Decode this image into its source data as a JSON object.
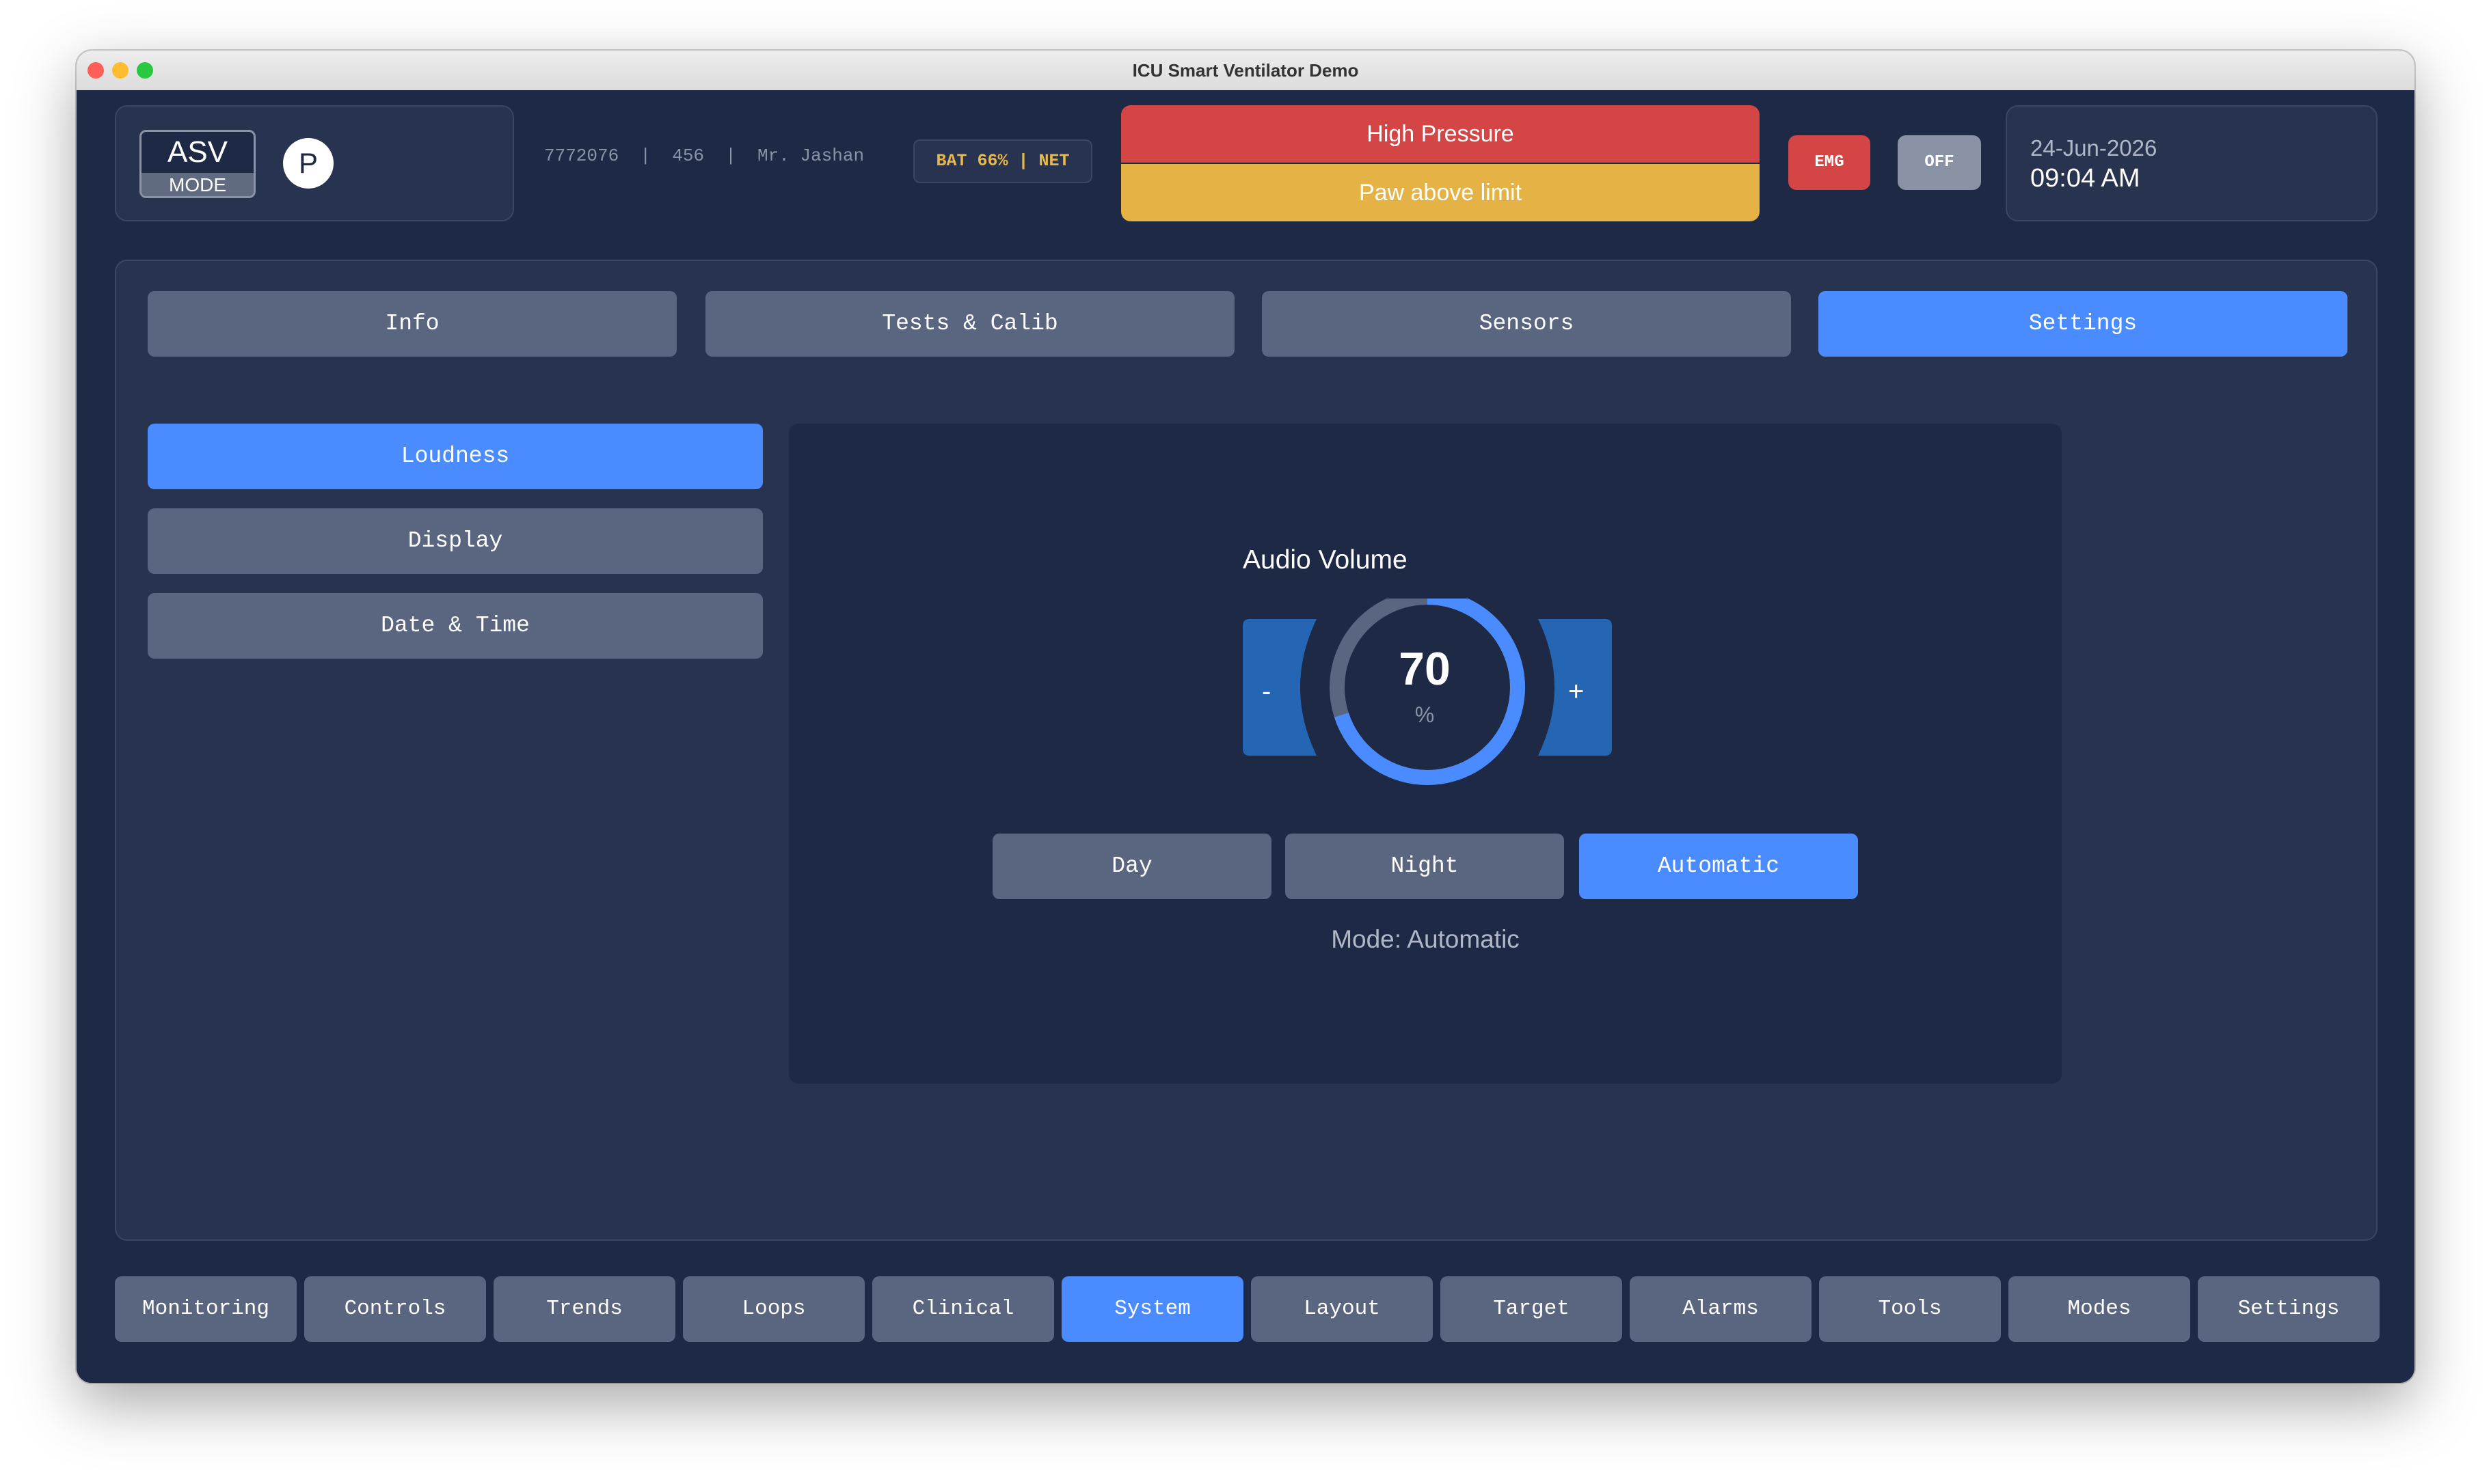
{
  "window": {
    "title": "ICU Smart Ventilator Demo"
  },
  "header": {
    "mode": {
      "name": "ASV",
      "label": "MODE",
      "badge": "P"
    },
    "patient_info": "7772076  |  456  |  Mr. Jashan",
    "status": "BAT 66% | NET",
    "alarms": {
      "primary": "High Pressure",
      "secondary": "Paw above limit"
    },
    "emg_label": "EMG",
    "off_label": "OFF",
    "date": "24-Jun-2026",
    "time": "09:04 AM"
  },
  "top_tabs": [
    {
      "label": "Info",
      "active": false
    },
    {
      "label": "Tests & Calib",
      "active": false
    },
    {
      "label": "Sensors",
      "active": false
    },
    {
      "label": "Settings",
      "active": true
    }
  ],
  "side_menu": [
    {
      "label": "Loudness",
      "active": true
    },
    {
      "label": "Display",
      "active": false
    },
    {
      "label": "Date & Time",
      "active": false
    }
  ],
  "audio": {
    "title": "Audio Volume",
    "value": "70",
    "unit": "%",
    "level_percent": 70,
    "minus_label": "-",
    "plus_label": "+",
    "modes": [
      {
        "label": "Day",
        "active": false
      },
      {
        "label": "Night",
        "active": false
      },
      {
        "label": "Automatic",
        "active": true
      }
    ],
    "mode_status": "Mode: Automatic"
  },
  "bottom_nav": [
    {
      "label": "Monitoring",
      "active": false
    },
    {
      "label": "Controls",
      "active": false
    },
    {
      "label": "Trends",
      "active": false
    },
    {
      "label": "Loops",
      "active": false
    },
    {
      "label": "Clinical",
      "active": false
    },
    {
      "label": "System",
      "active": true
    },
    {
      "label": "Layout",
      "active": false
    },
    {
      "label": "Target",
      "active": false
    },
    {
      "label": "Alarms",
      "active": false
    },
    {
      "label": "Tools",
      "active": false
    },
    {
      "label": "Modes",
      "active": false
    },
    {
      "label": "Settings",
      "active": false
    }
  ],
  "colors": {
    "accent": "#4a8cff",
    "background": "#1e2945",
    "panel": "#28334f",
    "button": "#5a6580",
    "alarm_red": "#d44545",
    "alarm_yellow": "#e5b245",
    "knob_blue": "#2566b4"
  }
}
